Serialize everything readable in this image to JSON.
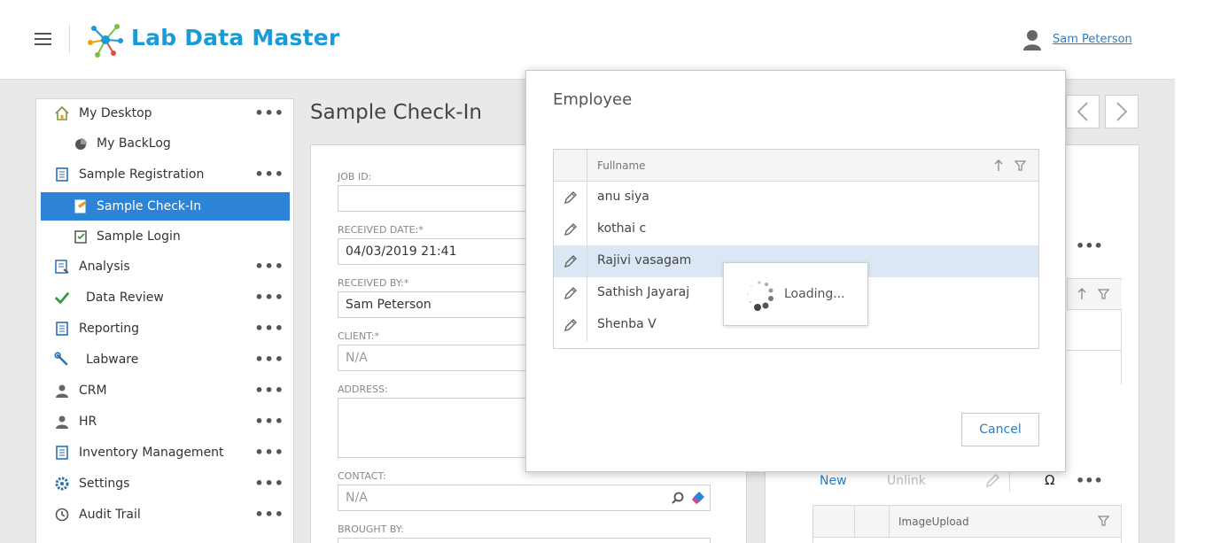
{
  "app": {
    "title": "Lab Data Master",
    "user": "Sam Peterson"
  },
  "sidebar": {
    "items": [
      {
        "label": "My Desktop",
        "icon": "home-icon",
        "has_menu": true
      },
      {
        "label": "My BackLog",
        "icon": "pie-chart-icon",
        "has_menu": false
      },
      {
        "label": "Sample Registration",
        "icon": "form-icon",
        "has_menu": true
      },
      {
        "label": "Sample Check-In",
        "icon": "checkin-icon",
        "has_menu": false,
        "active": true
      },
      {
        "label": "Sample Login",
        "icon": "clipboard-check-icon",
        "has_menu": false
      },
      {
        "label": "Analysis",
        "icon": "analysis-icon",
        "has_menu": true
      },
      {
        "label": "Data Review",
        "icon": "checkmark-icon",
        "has_menu": true
      },
      {
        "label": "Reporting",
        "icon": "report-icon",
        "has_menu": true
      },
      {
        "label": "Labware",
        "icon": "wrench-icon",
        "has_menu": true
      },
      {
        "label": "CRM",
        "icon": "person-icon",
        "has_menu": true
      },
      {
        "label": "HR",
        "icon": "person-icon",
        "has_menu": true
      },
      {
        "label": "Inventory Management",
        "icon": "form-icon",
        "has_menu": true
      },
      {
        "label": "Settings",
        "icon": "gear-icon",
        "has_menu": true
      },
      {
        "label": "Audit Trail",
        "icon": "history-icon",
        "has_menu": true
      }
    ],
    "menu_glyph": "•••"
  },
  "page": {
    "title": "Sample Check-In"
  },
  "form": {
    "job_id_label": "JOB ID:",
    "job_id_value": "",
    "received_date_label": "RECEIVED DATE:*",
    "received_date_value": "04/03/2019 21:41",
    "received_by_label": "RECEIVED BY:*",
    "received_by_value": "Sam Peterson",
    "client_label": "CLIENT:*",
    "client_value": "N/A",
    "address_label": "ADDRESS:",
    "address_value": "",
    "contact_label": "CONTACT:",
    "contact_value": "N/A",
    "brought_by_label": "BROUGHT BY:"
  },
  "right_panel": {
    "new_label": "New",
    "unlink_label": "Unlink",
    "omega": "Ω",
    "menu_glyph": "•••",
    "image_col": "ImageUpload"
  },
  "modal": {
    "title": "Employee",
    "column": "Fullname",
    "rows": [
      "anu siya",
      "kothai c",
      "Rajivi vasagam",
      "Sathish Jayaraj",
      "Shenba V"
    ],
    "selected_index": 2,
    "loading_text": "Loading...",
    "cancel_label": "Cancel"
  },
  "colors": {
    "accent": "#2d84d6",
    "brand": "#1a9ad6",
    "selected_row": "#dbe7f4"
  }
}
